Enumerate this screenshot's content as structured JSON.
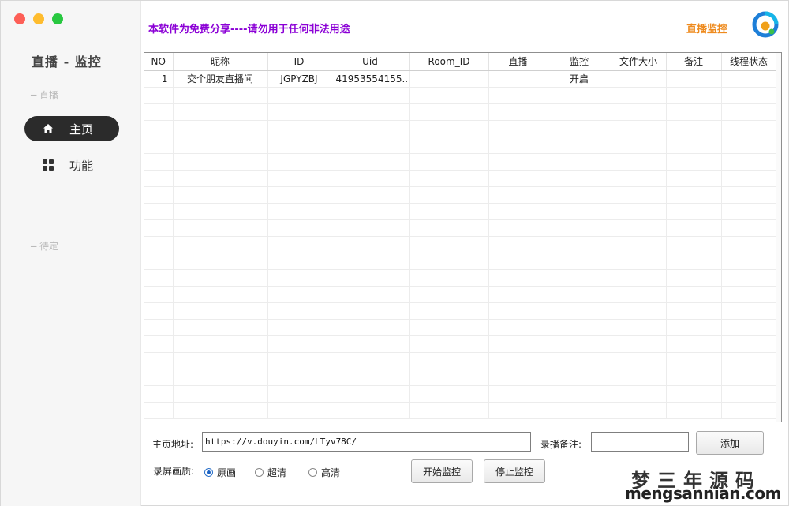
{
  "sidebar": {
    "title": "直播 - 监控",
    "section_live": "━ 直播",
    "section_pending": "━ 待定",
    "items": [
      {
        "label": "主页",
        "icon": "home-icon",
        "active": true
      },
      {
        "label": "功能",
        "icon": "grid-icon",
        "active": false
      }
    ]
  },
  "header": {
    "notice": "本软件为免费分享----请勿用于任何非法用途",
    "brand": "直播监控",
    "brand_icon": "app-logo-icon"
  },
  "table": {
    "columns": [
      "NO",
      "昵称",
      "ID",
      "Uid",
      "Room_ID",
      "直播",
      "监控",
      "文件大小",
      "备注",
      "线程状态"
    ],
    "rows": [
      [
        "1",
        "交个朋友直播间",
        "JGPYZBJ",
        "41953554155...",
        "",
        "",
        "开启",
        "",
        "",
        ""
      ]
    ]
  },
  "form": {
    "home_label": "主页地址:",
    "home_value": "https://v.douyin.com/LTyv78C/",
    "note_label": "录播备注:",
    "note_value": "",
    "add_button": "添加",
    "quality_label": "录屏画质:",
    "quality_options": [
      "原画",
      "超清",
      "高清"
    ],
    "quality_selected": "原画",
    "start_button": "开始监控",
    "stop_button": "停止监控"
  },
  "watermark": {
    "cn": "梦三年源码",
    "en": "mengsannian.com"
  },
  "colors": {
    "notice": "#8b00d6",
    "brand": "#ee8a1d",
    "nav_active_bg": "#2b2b2b"
  }
}
